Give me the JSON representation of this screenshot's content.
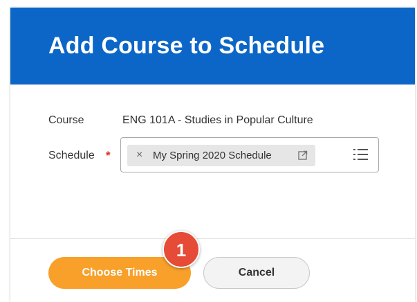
{
  "dialog": {
    "title": "Add Course to Schedule"
  },
  "form": {
    "course_label": "Course",
    "course_value": "ENG 101A - Studies in Popular Culture",
    "schedule_label": "Schedule",
    "required_marker": "*",
    "schedule_selected": {
      "remove_glyph": "×",
      "text": "My Spring 2020 Schedule",
      "icon": "external-link-icon"
    },
    "prompt_icon": "list-icon"
  },
  "footer": {
    "primary_label": "Choose Times",
    "secondary_label": "Cancel"
  },
  "annotation": {
    "step_number": "1"
  },
  "colors": {
    "header": "#0b66c7",
    "primary_button": "#f8a02a",
    "required": "#de2f22",
    "badge": "#e54b36"
  }
}
